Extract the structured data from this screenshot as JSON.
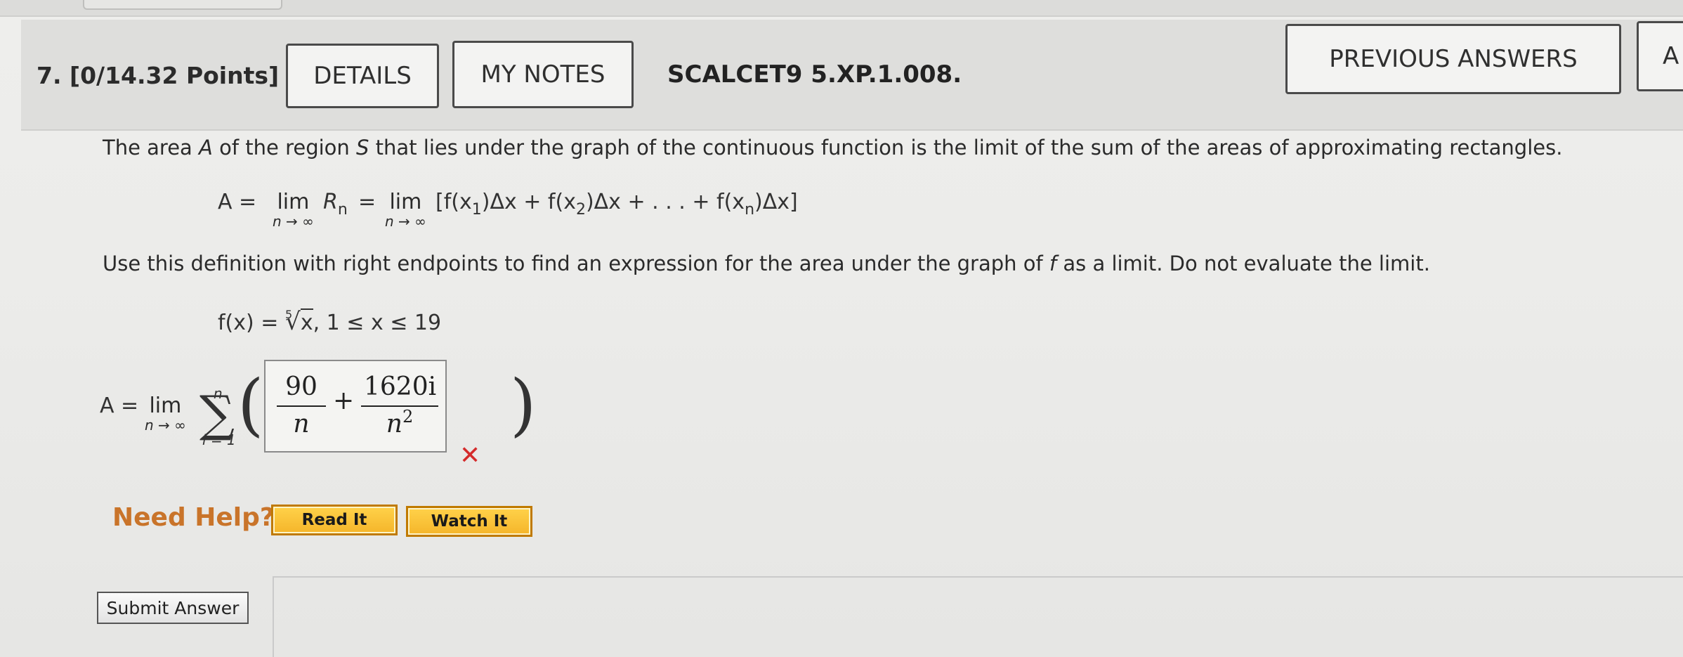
{
  "header": {
    "question_label": "7. [0/14.32 Points]",
    "details_button": "DETAILS",
    "my_notes_button": "MY NOTES",
    "problem_code": "SCALCET9 5.XP.1.008.",
    "previous_answers_button": "PREVIOUS ANSWERS",
    "cut_button": "A"
  },
  "problem": {
    "intro": "The area A of the region S that lies under the graph of the continuous function is the limit of the sum of the areas of approximating rectangles.",
    "definition_lhs": "A =",
    "lim": "lim",
    "lim_under": "n → ∞",
    "R": "R",
    "R_sub": "n",
    "equals": "=",
    "sum_open": "[f(x",
    "sub1": "1",
    "part1": ")Δx + f(x",
    "sub2": "2",
    "part2": ")Δx + . . . + f(x",
    "subn": "n",
    "part3": ")Δx]",
    "instruction": "Use this definition with right endpoints to find an expression for the area under the graph of f as a limit. Do not evaluate the limit.",
    "function_lhs": "f(x) =",
    "root_index": "5",
    "radicand": "x",
    "function_domain": ", 1 ≤ x ≤ 19"
  },
  "answer": {
    "lhs": "A =",
    "lim": "lim",
    "lim_under": "n → ∞",
    "sigma_top": "n",
    "sigma_bottom": "i = 1",
    "frac1_num": "90",
    "frac1_den": "n",
    "plus": "+",
    "frac2_num": "1620i",
    "frac2_den": "n",
    "frac2_den_exp": "2",
    "status": "incorrect",
    "status_icon": "x-mark-icon",
    "status_color": "#d42b2b"
  },
  "help": {
    "label": "Need Help?",
    "read_it": "Read It",
    "watch_it": "Watch It"
  },
  "submit": {
    "label": "Submit Answer"
  }
}
